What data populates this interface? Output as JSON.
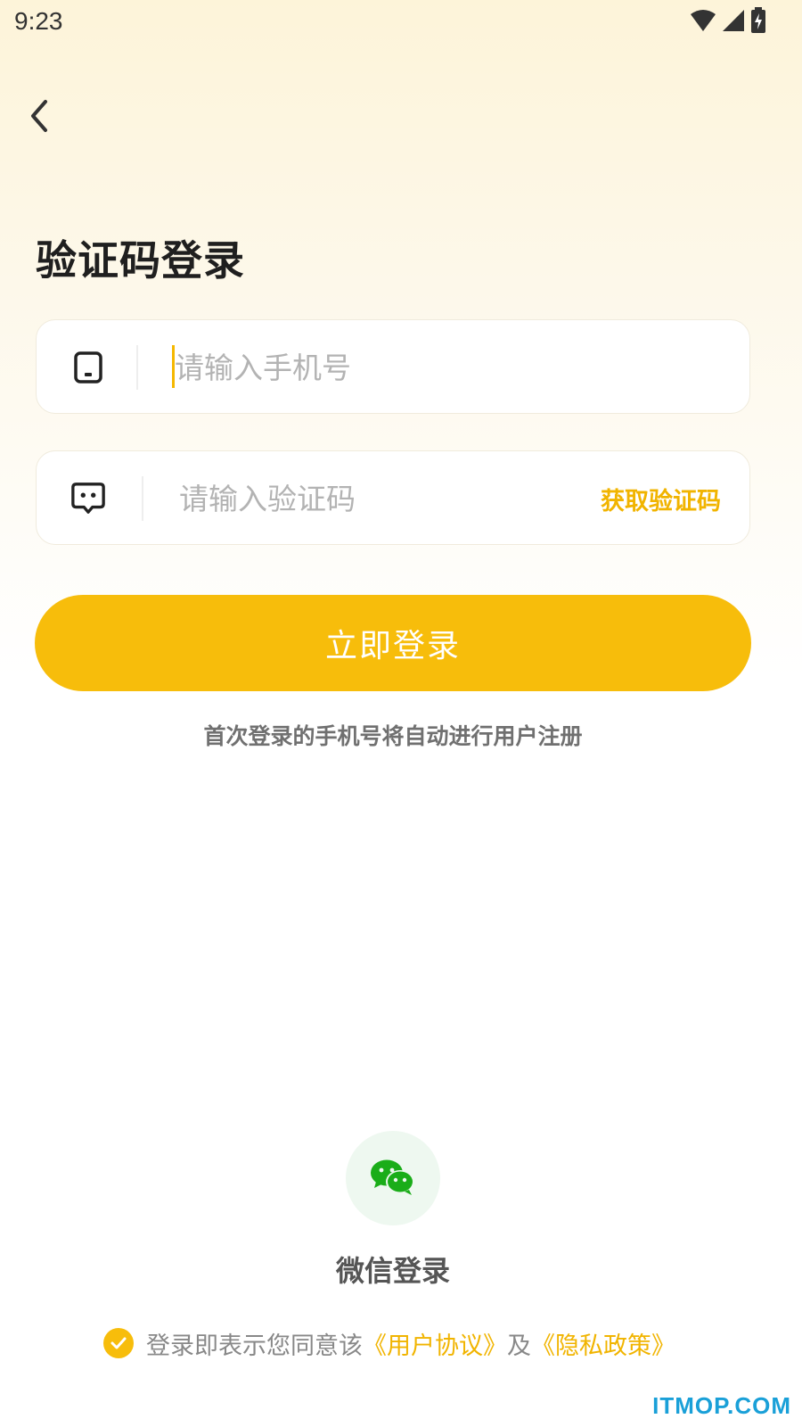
{
  "status_bar": {
    "time": "9:23"
  },
  "header": {
    "back_icon": "chevron-left-icon"
  },
  "title": "验证码登录",
  "phone_field": {
    "icon": "phone-icon",
    "placeholder": "请输入手机号",
    "value": ""
  },
  "code_field": {
    "icon": "message-icon",
    "placeholder": "请输入验证码",
    "value": "",
    "get_code_label": "获取验证码"
  },
  "login_button": {
    "label": "立即登录"
  },
  "hint": "首次登录的手机号将自动进行用户注册",
  "wechat": {
    "icon": "wechat-icon",
    "label": "微信登录"
  },
  "agreement": {
    "checked": true,
    "prefix": "登录即表示您同意该",
    "user_agreement": "《用户协议》",
    "conjunction": "及",
    "privacy_policy": "《隐私政策》"
  },
  "watermark": "ITMOP.COM",
  "colors": {
    "accent": "#f7bd0b",
    "accent_text": "#f1b400",
    "wechat_green": "#1aad19"
  }
}
